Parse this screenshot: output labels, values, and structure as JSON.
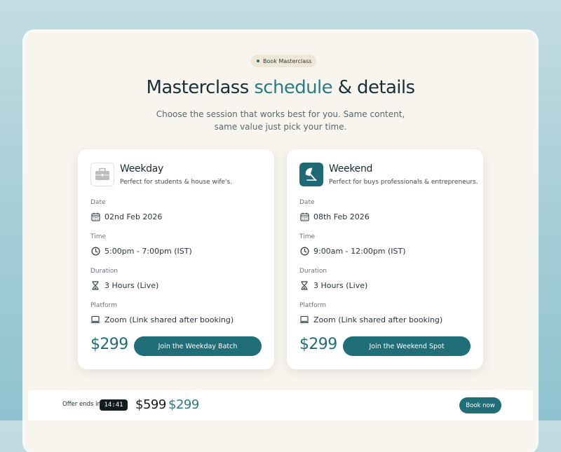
{
  "badge": {
    "label": "Book Masterclass"
  },
  "heading": {
    "part1": "Masterclass ",
    "accent": "schedule",
    "part2": " & details"
  },
  "subheading": {
    "line1": "Choose the session that works best for you. Same content,",
    "line2": "same value just pick your time."
  },
  "cards": [
    {
      "title": "Weekday",
      "description": "Perfect for students & house wife's.",
      "icon": "briefcase-icon",
      "date_label": "Date",
      "date": "02nd Feb 2026",
      "time_label": "Time",
      "time": "5:00pm - 7:00pm (IST)",
      "duration_label": "Duration",
      "duration": "3 Hours (Live)",
      "platform_label": "Platform",
      "platform": "Zoom (Link shared after booking)",
      "price": "$299",
      "button": "Join the Weekday Batch"
    },
    {
      "title": "Weekend",
      "description": "Perfect for buys professionals & entrepreneurs.",
      "icon": "umbrella-icon",
      "date_label": "Date",
      "date": "08th Feb 2026",
      "time_label": "Time",
      "time": "9:00am - 12:00pm (IST)",
      "duration_label": "Duration",
      "duration": "3 Hours (Live)",
      "platform_label": "Platform",
      "platform": "Zoom (Link shared after booking)",
      "price": "$299",
      "button": "Join the Weekend Spot"
    }
  ],
  "footer": {
    "offer_label": "Offer ends in",
    "timer": "14:41",
    "old_price": "$599",
    "new_price": "$299",
    "book_button": "Book now"
  },
  "colors": {
    "accent": "#2a7d86",
    "button": "#1f6e78",
    "panel": "#f8f5ee"
  }
}
